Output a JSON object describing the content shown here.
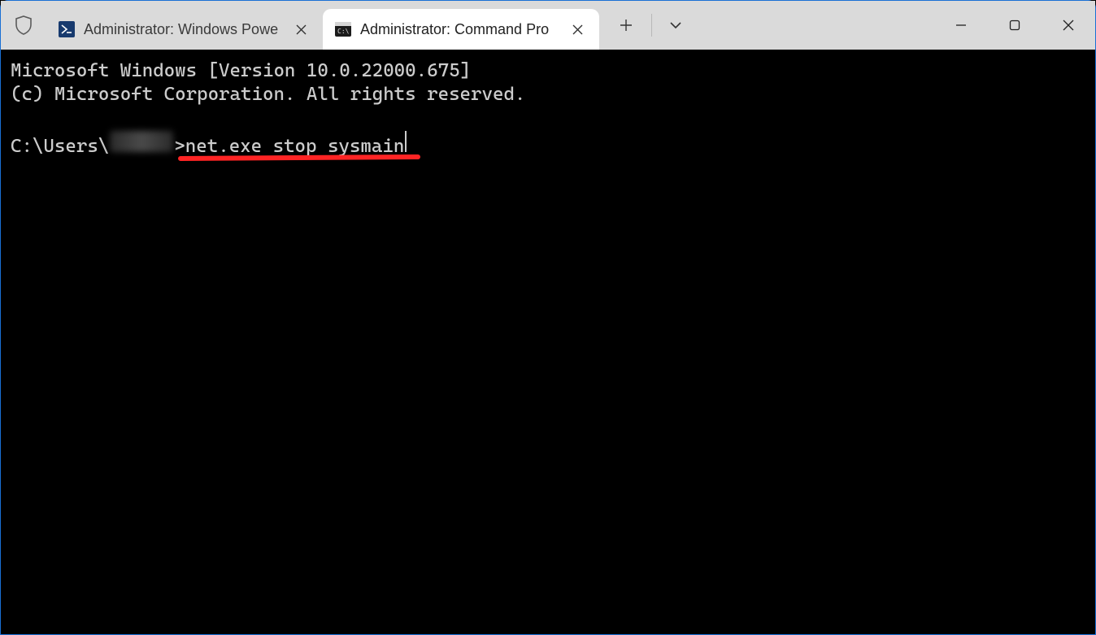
{
  "titlebar": {
    "tabs": [
      {
        "label": "Administrator: Windows Powe",
        "icon": "powershell-icon",
        "active": false
      },
      {
        "label": "Administrator: Command Pro",
        "icon": "cmd-icon",
        "active": true
      }
    ],
    "add_tab_tooltip": "New tab",
    "dropdown_tooltip": "New tab dropdown",
    "window_controls": {
      "minimize": "Minimize",
      "maximize": "Maximize",
      "close": "Close"
    }
  },
  "terminal": {
    "banner_line1": "Microsoft Windows [Version 10.0.22000.675]",
    "banner_line2": "(c) Microsoft Corporation. All rights reserved.",
    "prompt_prefix": "C:\\Users\\",
    "prompt_username_redacted": true,
    "prompt_suffix": ">",
    "command": "net.exe stop sysmain"
  },
  "annotation": {
    "underline_target": "command",
    "color": "#ff2424"
  }
}
